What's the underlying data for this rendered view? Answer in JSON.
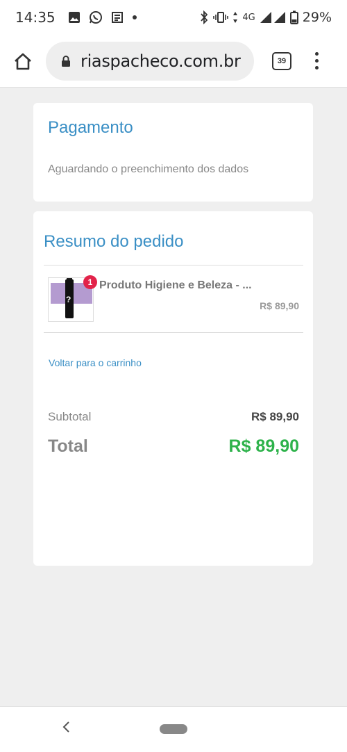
{
  "status_bar": {
    "time": "14:35",
    "network": "4G",
    "battery": "29%",
    "icons_left": [
      "image-icon",
      "whatsapp-icon",
      "news-icon",
      "dot-icon"
    ],
    "icons_right": [
      "bluetooth-icon",
      "vibrate-icon",
      "signal-icon",
      "battery-icon"
    ]
  },
  "browser": {
    "url": "riaspacheco.com.br",
    "tab_count": "39"
  },
  "payment": {
    "title": "Pagamento",
    "status": "Aguardando o preenchimento dos dados"
  },
  "summary": {
    "title": "Resumo do pedido",
    "items": [
      {
        "name": "Produto Higiene e Beleza - ...",
        "price": "R$ 89,90",
        "quantity": "1",
        "thumb_char": "?"
      }
    ],
    "back_link": "Voltar para o carrinho",
    "subtotal_label": "Subtotal",
    "subtotal_value": "R$ 89,90",
    "total_label": "Total",
    "total_value": "R$ 89,90"
  },
  "colors": {
    "accent": "#3a8fc5",
    "total_green": "#2db24a",
    "badge_red": "#e2234a",
    "background": "#efefef"
  }
}
